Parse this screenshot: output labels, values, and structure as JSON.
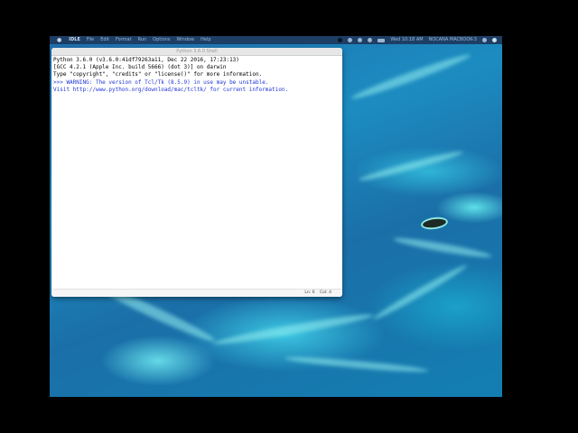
{
  "menubar": {
    "apple_icon": "apple-icon",
    "app_name": "IDLE",
    "items": [
      "File",
      "Edit",
      "Format",
      "Run",
      "Options",
      "Window",
      "Help"
    ],
    "clock": "Wed 10:18 AM",
    "user": "NOCANA MACBOOK-3"
  },
  "window": {
    "title": "Python 3.6.0 Shell"
  },
  "shell": {
    "lines": [
      "Python 3.6.0 (v3.6.0:41df79263a11, Dec 22 2016, 17:23:13)",
      "[GCC 4.2.1 (Apple Inc. build 5666) (dot 3)] on darwin",
      "Type \"copyright\", \"credits\" or \"license()\" for more information.",
      ">>> WARNING: The version of Tcl/Tk (8.5.9) in use may be unstable.",
      "Visit http://www.python.org/download/mac/tcltk/ for current information."
    ]
  },
  "status": {
    "line": "Ln: 6",
    "col": "Col: 4"
  },
  "colors": {
    "shell_output_blue": "#1f35d6",
    "menubar_bg": "#1d3f66"
  }
}
